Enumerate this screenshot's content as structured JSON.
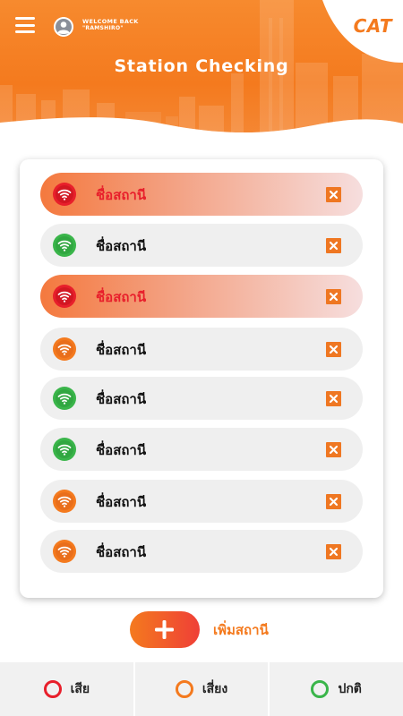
{
  "header": {
    "welcome_line": "WELCOME BACK",
    "username": "\"RAMSHIRO\"",
    "title": "Station Checking",
    "logo": "CAT",
    "menu_icon": "hamburger-menu-icon",
    "avatar_icon": "user-avatar-icon"
  },
  "colors": {
    "brand_orange": "#f47a1e",
    "status_broken": "#e81f2b",
    "status_risk": "#f47a1e",
    "status_normal": "#3ab54a"
  },
  "stations": [
    {
      "name": "ชื่อสถานี",
      "status": "broken"
    },
    {
      "name": "ชื่อสถานี",
      "status": "normal"
    },
    {
      "name": "ชื่อสถานี",
      "status": "broken"
    },
    {
      "name": "ชื่อสถานี",
      "status": "risk"
    },
    {
      "name": "ชื่อสถานี",
      "status": "normal"
    },
    {
      "name": "ชื่อสถานี",
      "status": "normal"
    },
    {
      "name": "ชื่อสถานี",
      "status": "risk"
    },
    {
      "name": "ชื่อสถานี",
      "status": "risk"
    }
  ],
  "add_station": {
    "label": "เพิ่มสถานี",
    "icon": "plus-icon"
  },
  "legend": [
    {
      "status": "broken",
      "label": "เสีย"
    },
    {
      "status": "risk",
      "label": "เสี่ยง"
    },
    {
      "status": "normal",
      "label": "ปกติ"
    }
  ]
}
